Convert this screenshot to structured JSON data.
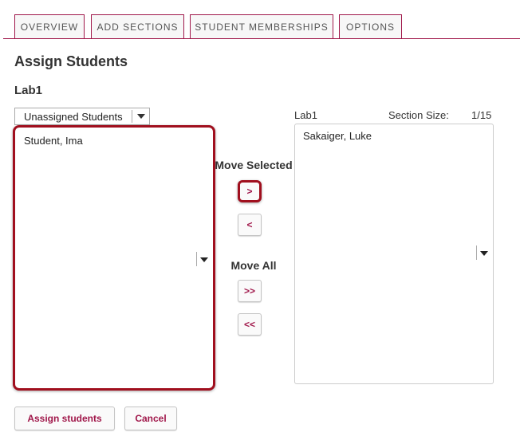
{
  "tabs": [
    {
      "label": "OVERVIEW"
    },
    {
      "label": "ADD SECTIONS"
    },
    {
      "label": "STUDENT MEMBERSHIPS"
    },
    {
      "label": "OPTIONS"
    }
  ],
  "page_title": "Assign Students",
  "section_name": "Lab1",
  "source_select": {
    "selected": "Unassigned Students"
  },
  "source_list": {
    "items": [
      "Student, Ima"
    ]
  },
  "controls": {
    "move_selected_label": "Move Selected",
    "move_right": ">",
    "move_left": "<",
    "move_all_label": "Move All",
    "move_all_right": ">>",
    "move_all_left": "<<"
  },
  "target": {
    "section_label": "Lab1",
    "size_label": "Section Size:",
    "size_value": "1/15",
    "items": [
      "Sakaiger, Luke"
    ]
  },
  "actions": {
    "assign": "Assign students",
    "cancel": "Cancel"
  },
  "colors": {
    "accent": "#a0174a",
    "highlight": "#a00f1e"
  },
  "icons": {
    "dropdown": "chevron-down-icon",
    "scroll": "scroll-down-arrow-icon"
  }
}
